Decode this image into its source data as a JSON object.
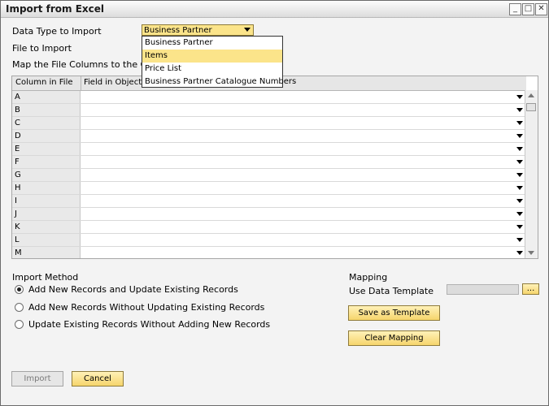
{
  "window": {
    "title": "Import from Excel",
    "controls": [
      "minimize",
      "maximize",
      "close"
    ]
  },
  "form": {
    "data_type_label": "Data Type to Import",
    "data_type_value": "Business Partner",
    "file_label": "File to Import",
    "map_label": "Map the File Columns to the Object"
  },
  "dropdown": {
    "options": [
      "Business Partner",
      "Items",
      "Price List",
      "Business Partner Catalogue Numbers"
    ],
    "highlighted": "Items"
  },
  "grid": {
    "headers": [
      "Column in File",
      "Field in Object"
    ],
    "rows": [
      "A",
      "B",
      "C",
      "D",
      "E",
      "F",
      "G",
      "H",
      "I",
      "J",
      "K",
      "L",
      "M"
    ]
  },
  "import_method": {
    "label": "Import Method",
    "options": [
      {
        "label": "Add New Records and Update Existing Records",
        "selected": true
      },
      {
        "label": "Add New Records Without Updating Existing Records",
        "selected": false
      },
      {
        "label": "Update Existing Records Without Adding New Records",
        "selected": false
      }
    ]
  },
  "mapping": {
    "label": "Mapping",
    "template_label": "Use Data Template",
    "template_value": "",
    "browse_label": "...",
    "save_template_label": "Save as Template",
    "clear_mapping_label": "Clear Mapping"
  },
  "footer": {
    "import_label": "Import",
    "cancel_label": "Cancel"
  },
  "colors": {
    "accent": "#fbe48a",
    "button": "#f6d56c"
  }
}
